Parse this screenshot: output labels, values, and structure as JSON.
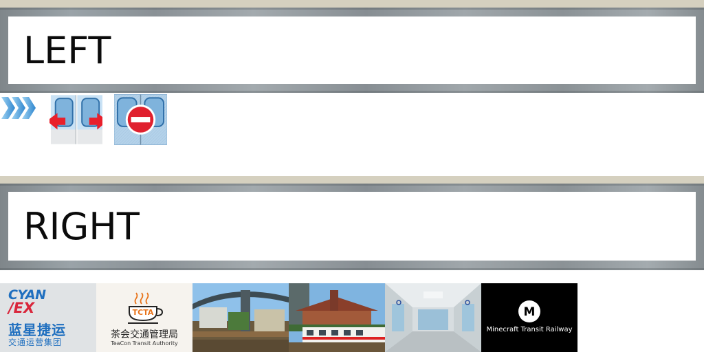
{
  "signs": {
    "left": {
      "text": "LEFT"
    },
    "right": {
      "text": "RIGHT"
    }
  },
  "icons": [
    {
      "name": "chevron-forward-icon"
    },
    {
      "name": "doors-open-outward-icon"
    },
    {
      "name": "doors-no-entry-icon"
    }
  ],
  "logos": {
    "cyan": {
      "line1": "CYAN",
      "line2": "EX",
      "zh": "蓝星捷运",
      "zh_sub": "交通运营集团"
    },
    "tcta": {
      "badge": "TCTA",
      "zh": "茶会交通管理局",
      "en": "TeaCon Transit Authority"
    },
    "mtr": {
      "letter": "M",
      "name": "Minecraft Transit Railway"
    }
  },
  "colors": {
    "beige": "#d5d0bf",
    "frame": "#8f969a",
    "sign_bg": "#ffffff",
    "cyan_blue": "#1f6fbf",
    "cyan_red": "#d9263b",
    "tcta_orange": "#e8731a",
    "no_entry_red": "#e0202e",
    "arrow_red": "#e8202c",
    "door_blue": "#7fb3dc"
  }
}
